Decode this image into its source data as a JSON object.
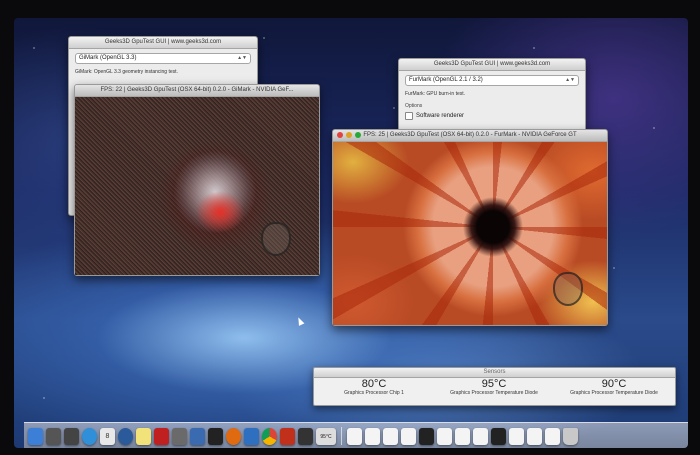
{
  "gimark_gui": {
    "title": "Geeks3D GpuTest GUI | www.geeks3d.com",
    "selected_test": "GiMark (OpenGL 3.3)",
    "description": "GiMark: OpenGL 3.3 geometry instancing test."
  },
  "gimark_render": {
    "title": "FPS: 22 | Geeks3D GpuTest (OSX 64-bit) 0.2.0 - GiMark - NVIDIA GeF..."
  },
  "furmark_gui": {
    "title": "Geeks3D GpuTest GUI | www.geeks3d.com",
    "selected_test": "FurMark (OpenGL 2.1 / 3.2)",
    "description": "FurMark: GPU burn-in test.",
    "options_label": "Options",
    "software_renderer_label": "Software renderer"
  },
  "furmark_render": {
    "title": "FPS: 25 | Geeks3D GpuTest (OSX 64-bit) 0.2.0 - FurMark - NVIDIA GeForce GT"
  },
  "sensors": {
    "title": "Sensors",
    "readings": [
      {
        "value": "80°C",
        "label": "Graphics Processor Chip 1"
      },
      {
        "value": "95°C",
        "label": "Graphics Processor Temperature Diode"
      },
      {
        "value": "90°C",
        "label": "Graphics Processor Temperature Diode"
      }
    ]
  },
  "dock": {
    "temp_badge": "95°C",
    "calendar_day": "8",
    "icons": [
      {
        "name": "finder-icon",
        "color": "#3b7fd6"
      },
      {
        "name": "launchpad-icon",
        "color": "#555"
      },
      {
        "name": "mission-control-icon",
        "color": "#444"
      },
      {
        "name": "safari-icon",
        "color": "#2f8fd8"
      },
      {
        "name": "calendar-icon",
        "color": "#e8e8e8"
      },
      {
        "name": "dashboard-icon",
        "color": "#2a5a9a"
      },
      {
        "name": "notes-icon",
        "color": "#f2e27a"
      },
      {
        "name": "photo-booth-icon",
        "color": "#c02020"
      },
      {
        "name": "photo-icon",
        "color": "#6a6a6a"
      },
      {
        "name": "utilities-icon",
        "color": "#3a6ab0"
      },
      {
        "name": "terminal-icon",
        "color": "#222"
      },
      {
        "name": "firefox-icon",
        "color": "#e06a10"
      },
      {
        "name": "xcode-icon",
        "color": "#2f6fc0"
      },
      {
        "name": "chrome-icon",
        "color": "#e0e0e0"
      },
      {
        "name": "pepper-icon",
        "color": "#c0301a"
      },
      {
        "name": "x11-icon",
        "color": "#333"
      }
    ],
    "doc_icons": 12
  }
}
